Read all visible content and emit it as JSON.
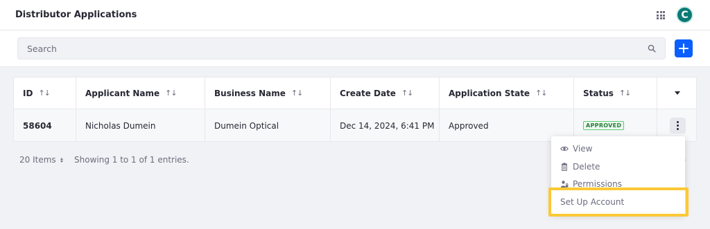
{
  "header": {
    "title": "Distributor Applications",
    "avatar_letter": "C",
    "avatar_color": "#0b7a75"
  },
  "search": {
    "placeholder": "Search",
    "value": ""
  },
  "accent": "#0b5fff",
  "table": {
    "columns": [
      {
        "label": "ID"
      },
      {
        "label": "Applicant Name"
      },
      {
        "label": "Business Name"
      },
      {
        "label": "Create Date"
      },
      {
        "label": "Application State"
      },
      {
        "label": "Status"
      }
    ],
    "rows": [
      {
        "id": "58604",
        "applicant_name": "Nicholas Dumein",
        "business_name": "Dumein Optical",
        "create_date": "Dec 14, 2024, 6:41 PM",
        "application_state": "Approved",
        "status": "APPROVED"
      }
    ]
  },
  "pagination": {
    "items_label": "20 Items",
    "info": "Showing 1 to 1 of 1 entries."
  },
  "action_menu": {
    "items": [
      {
        "label": "View",
        "icon": "eye-icon"
      },
      {
        "label": "Delete",
        "icon": "trash-icon"
      },
      {
        "label": "Permissions",
        "icon": "permissions-icon"
      },
      {
        "label": "Set Up Account",
        "icon": ""
      }
    ],
    "highlighted": "Set Up Account",
    "highlight_color": "#fcc935"
  }
}
